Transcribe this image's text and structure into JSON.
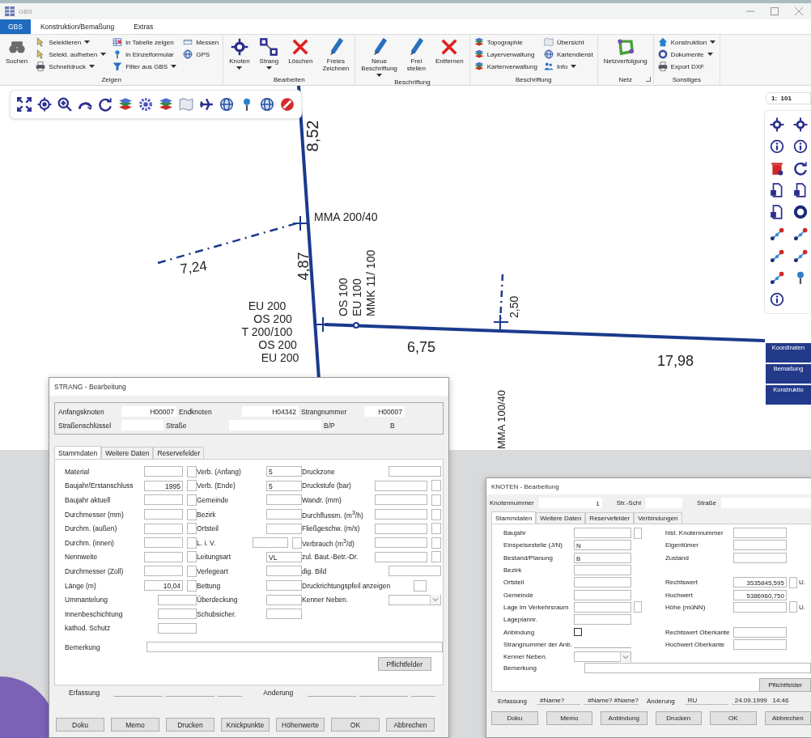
{
  "window": {
    "title": "GBS"
  },
  "menu_tabs": [
    {
      "label": "GBS",
      "selected": true
    },
    {
      "label": "Konstruktion/Bemaßung",
      "selected": false
    },
    {
      "label": "Extras",
      "selected": false
    }
  ],
  "ribbon": [
    {
      "label": "Zeigen",
      "columns": [
        [
          {
            "label": "Suchen",
            "kind": "large",
            "dropdown": false
          }
        ],
        [
          {
            "label": "Selektieren",
            "kind": "small",
            "dropdown": true
          },
          {
            "label": "Selekt. aufheben",
            "kind": "small",
            "dropdown": true
          },
          {
            "label": "Schnelldruck",
            "kind": "small",
            "dropdown": true
          }
        ],
        [
          {
            "label": "in Tabelle zeigen",
            "kind": "small",
            "dropdown": false
          },
          {
            "label": "in Einzelformular",
            "kind": "small",
            "dropdown": false
          },
          {
            "label": "Filter aus GBS",
            "kind": "small",
            "dropdown": true
          }
        ],
        [
          {
            "label": "Messen",
            "kind": "small",
            "dropdown": false
          },
          {
            "label": "GPS",
            "kind": "small",
            "dropdown": false
          }
        ]
      ]
    },
    {
      "label": "Bearbeiten",
      "columns": [
        [
          {
            "label": "Knoten",
            "kind": "large",
            "dropdown": true
          }
        ],
        [
          {
            "label": "Strang",
            "kind": "large",
            "dropdown": true
          }
        ],
        [
          {
            "label": "Löschen",
            "kind": "large",
            "dropdown": false
          }
        ],
        [
          {
            "label": "Freies\nZeichnen",
            "kind": "large",
            "dropdown": false
          }
        ]
      ]
    },
    {
      "label": "Beschriftung",
      "columns": [
        [
          {
            "label": "Neue\nBeschriftung",
            "kind": "large",
            "dropdown": true
          }
        ],
        [
          {
            "label": "Frei\nstellen",
            "kind": "large",
            "dropdown": false
          }
        ],
        [
          {
            "label": "Entfernen",
            "kind": "large",
            "dropdown": false
          }
        ]
      ]
    },
    {
      "label": "Beschriftung",
      "columns": [
        [
          {
            "label": "Topographie",
            "kind": "small",
            "dropdown": false
          },
          {
            "label": "Layerverwaltung",
            "kind": "small",
            "dropdown": false
          },
          {
            "label": "Kartenverwaltung",
            "kind": "small",
            "dropdown": false
          }
        ],
        [
          {
            "label": "Übersicht",
            "kind": "small",
            "dropdown": false
          },
          {
            "label": "Kartendienst",
            "kind": "small",
            "dropdown": false
          },
          {
            "label": "Info",
            "kind": "small",
            "dropdown": true
          }
        ]
      ]
    },
    {
      "label": "Netz",
      "columns": [
        [
          {
            "label": "Netzverfolgung",
            "kind": "large",
            "dropdown": false
          }
        ]
      ]
    },
    {
      "label": "Sonstiges",
      "columns": [
        [
          {
            "label": "Konstruktion",
            "kind": "small",
            "dropdown": true
          },
          {
            "label": "Dokumente",
            "kind": "small",
            "dropdown": true
          },
          {
            "label": "Export DXF",
            "kind": "small",
            "dropdown": false
          }
        ]
      ]
    }
  ],
  "map": {
    "scale": "1:  101",
    "labels": [
      "8,52",
      "MMA 200/40",
      "7,24",
      "4,87",
      "EU 200",
      "OS 200",
      "T 200/100",
      "OS 200",
      "EU 200",
      "OS 100",
      "EU 100",
      "MMK 11/ 100",
      "2,50",
      "6,75",
      "17,98",
      "MMA 100/40"
    ]
  },
  "side_buttons": [
    "Koordinaten",
    "Bemaßung",
    "Konstruktio"
  ],
  "strang_dialog": {
    "title": "STRANG - Bearbeitung",
    "header": [
      [
        {
          "label": "Anfangsknoten",
          "value": "H00007",
          "kind": "field"
        },
        {
          "label": "Endknoten",
          "value": "H04342",
          "kind": "field"
        },
        {
          "label": "Strangnummer",
          "value": "H00007",
          "kind": "field"
        }
      ],
      [
        {
          "label": "Straßenschlüssel",
          "kind": "field"
        },
        {
          "label": "Straße",
          "kind": "field"
        },
        {
          "label": "B/P",
          "value": "B",
          "kind": "text"
        }
      ]
    ],
    "tabs": [
      {
        "label": "Stammdaten",
        "selected": true
      },
      {
        "label": "Weitere Daten",
        "selected": false
      },
      {
        "label": "Reservefelder",
        "selected": false
      }
    ],
    "rows": [
      [
        {
          "label": "Material",
          "kind": "input_flag"
        },
        {
          "label": "Verb. (Anfang)",
          "value": "5",
          "kind": "input"
        },
        {
          "label": "Druckzone",
          "kind": "input"
        }
      ],
      [
        {
          "label": "Baujahr/Erstanschluss",
          "value": "1995",
          "kind": "number_flag"
        },
        {
          "label": "Verb. (Ende)",
          "value": "5",
          "kind": "input"
        },
        {
          "label": "Druckstufe (bar)",
          "kind": "input_flag"
        }
      ],
      [
        {
          "label": "Baujahr aktuell",
          "kind": "input_flag"
        },
        {
          "label": "Gemeinde",
          "kind": "input"
        },
        {
          "label": "Wandr. (mm)",
          "kind": "input_flag"
        }
      ],
      [
        {
          "label": "Durchmesser (mm)",
          "kind": "input_flag"
        },
        {
          "label": "Bezirk",
          "kind": "input"
        },
        {
          "label": "Durchflussm. (m$^{3}$/h)",
          "kind": "input_flag"
        }
      ],
      [
        {
          "label": "Durchm. (außen)",
          "kind": "input_flag"
        },
        {
          "label": "Ortsteil",
          "kind": "input"
        },
        {
          "label": "Fließgeschw. (m/s)",
          "kind": "input_flag"
        }
      ],
      [
        {
          "label": "Durchm. (innen)",
          "kind": "input_flag"
        },
        {
          "label": "L. i. V.",
          "kind": "input_flag"
        },
        {
          "label": "Verbrauch (m$^{3}$/d)",
          "kind": "input_flag"
        }
      ],
      [
        {
          "label": "Nennweite",
          "kind": "input_flag"
        },
        {
          "label": "Leitungsart",
          "value": "VL",
          "kind": "input"
        },
        {
          "label": "zul. Baut.-Betr.-Dr.",
          "kind": "input_flag"
        }
      ],
      [
        {
          "label": "Durchmesser (Zoll)",
          "kind": "input_flag"
        },
        {
          "label": "Verlegeart",
          "kind": "input"
        },
        {
          "label": "dig. Bild",
          "kind": "input"
        }
      ],
      [
        {
          "label": "Länge (m)",
          "value": "10,04",
          "kind": "number_flag"
        },
        {
          "label": "Bettung",
          "kind": "input"
        },
        {
          "label": "Druckrichtungspfeil anzeigen",
          "kind": "flag"
        }
      ],
      [
        {
          "label": "Ummantelung",
          "kind": "input"
        },
        {
          "label": "Überdeckung",
          "kind": "input"
        },
        {
          "label": "Kenner Neben.",
          "kind": "combo"
        }
      ],
      [
        {
          "label": "Innenbeschichtung",
          "kind": "input"
        },
        {
          "label": "Schubsicher.",
          "kind": "input"
        }
      ],
      [
        {
          "label": "kathod. Schutz",
          "kind": "input"
        }
      ]
    ],
    "remark_label": "Bemerkung",
    "required_button": "Pflichtfelder",
    "footer": [
      {
        "label": "Erfassung"
      },
      {
        "label": "Anderung"
      }
    ],
    "buttons": [
      "Doku",
      "Memo",
      "Drucken",
      "Knickpunkte",
      "Höhenwerte",
      "OK",
      "Abbrechen"
    ]
  },
  "knoten_dialog": {
    "title": "KNOTEN - Bearbeitung",
    "header": [
      {
        "label": "Knotennummer",
        "value": "1"
      },
      {
        "label": "Str.-Schl"
      },
      {
        "label": "Straße"
      }
    ],
    "tabs": [
      {
        "label": "Stammdaten",
        "selected": true
      },
      {
        "label": "Weitere Daten",
        "selected": false
      },
      {
        "label": "Reservefelder",
        "selected": false
      },
      {
        "label": "Verbindungen",
        "selected": false
      }
    ],
    "rows": [
      [
        {
          "label": "Baujahr",
          "kind": "input_flag"
        },
        {
          "label": "hist. Knotennummer",
          "kind": "input"
        }
      ],
      [
        {
          "label": "Einspeisestelle (J/N)",
          "value": "N",
          "kind": "input"
        },
        {
          "label": "Eigentümer",
          "kind": "input"
        }
      ],
      [
        {
          "label": "Bestand/Planung",
          "value": "B",
          "kind": "input"
        },
        {
          "label": "Zustand",
          "kind": "input"
        }
      ],
      [
        {
          "label": "Bezirk",
          "kind": "input"
        }
      ],
      [
        {
          "label": "Ortsteil",
          "kind": "input"
        },
        {
          "label": "Rechtswert",
          "value": "3535845,595",
          "kind": "number_flag",
          "suffix": "U."
        }
      ],
      [
        {
          "label": "Gemeinde",
          "kind": "input"
        },
        {
          "label": "Hochwert",
          "value": "5386960,750",
          "kind": "number"
        }
      ],
      [
        {
          "label": "Lage im Verkehrsraum",
          "kind": "input_flag"
        },
        {
          "label": "Höhe (müNN)",
          "kind": "input_flag",
          "suffix": "U."
        }
      ],
      [
        {
          "label": "Lageplannr.",
          "kind": "input"
        }
      ],
      [
        {
          "label": "Anbindung",
          "kind": "check",
          "checked": false
        },
        {
          "label": "Rechtswert Oberkante",
          "kind": "input"
        }
      ],
      [
        {
          "label": "Strangnummer der Anb.",
          "kind": "line"
        },
        {
          "label": "Hochwert Oberkante",
          "kind": "input"
        }
      ],
      [
        {
          "label": "Kenner Neben.",
          "kind": "combo"
        }
      ]
    ],
    "remark_label": "Bemerkung",
    "required_button": "Pflichtfelder",
    "footer": [
      {
        "label": "Erfassung",
        "values": [
          "#Name?",
          "#Name? #Name?"
        ]
      },
      {
        "label": "Änderung",
        "values": [
          "RU",
          "24.09.1999   14:46"
        ]
      }
    ],
    "buttons": [
      "Doku",
      "Memo",
      "Anbindung",
      "Drucken",
      "OK",
      "Abbrechen"
    ]
  }
}
